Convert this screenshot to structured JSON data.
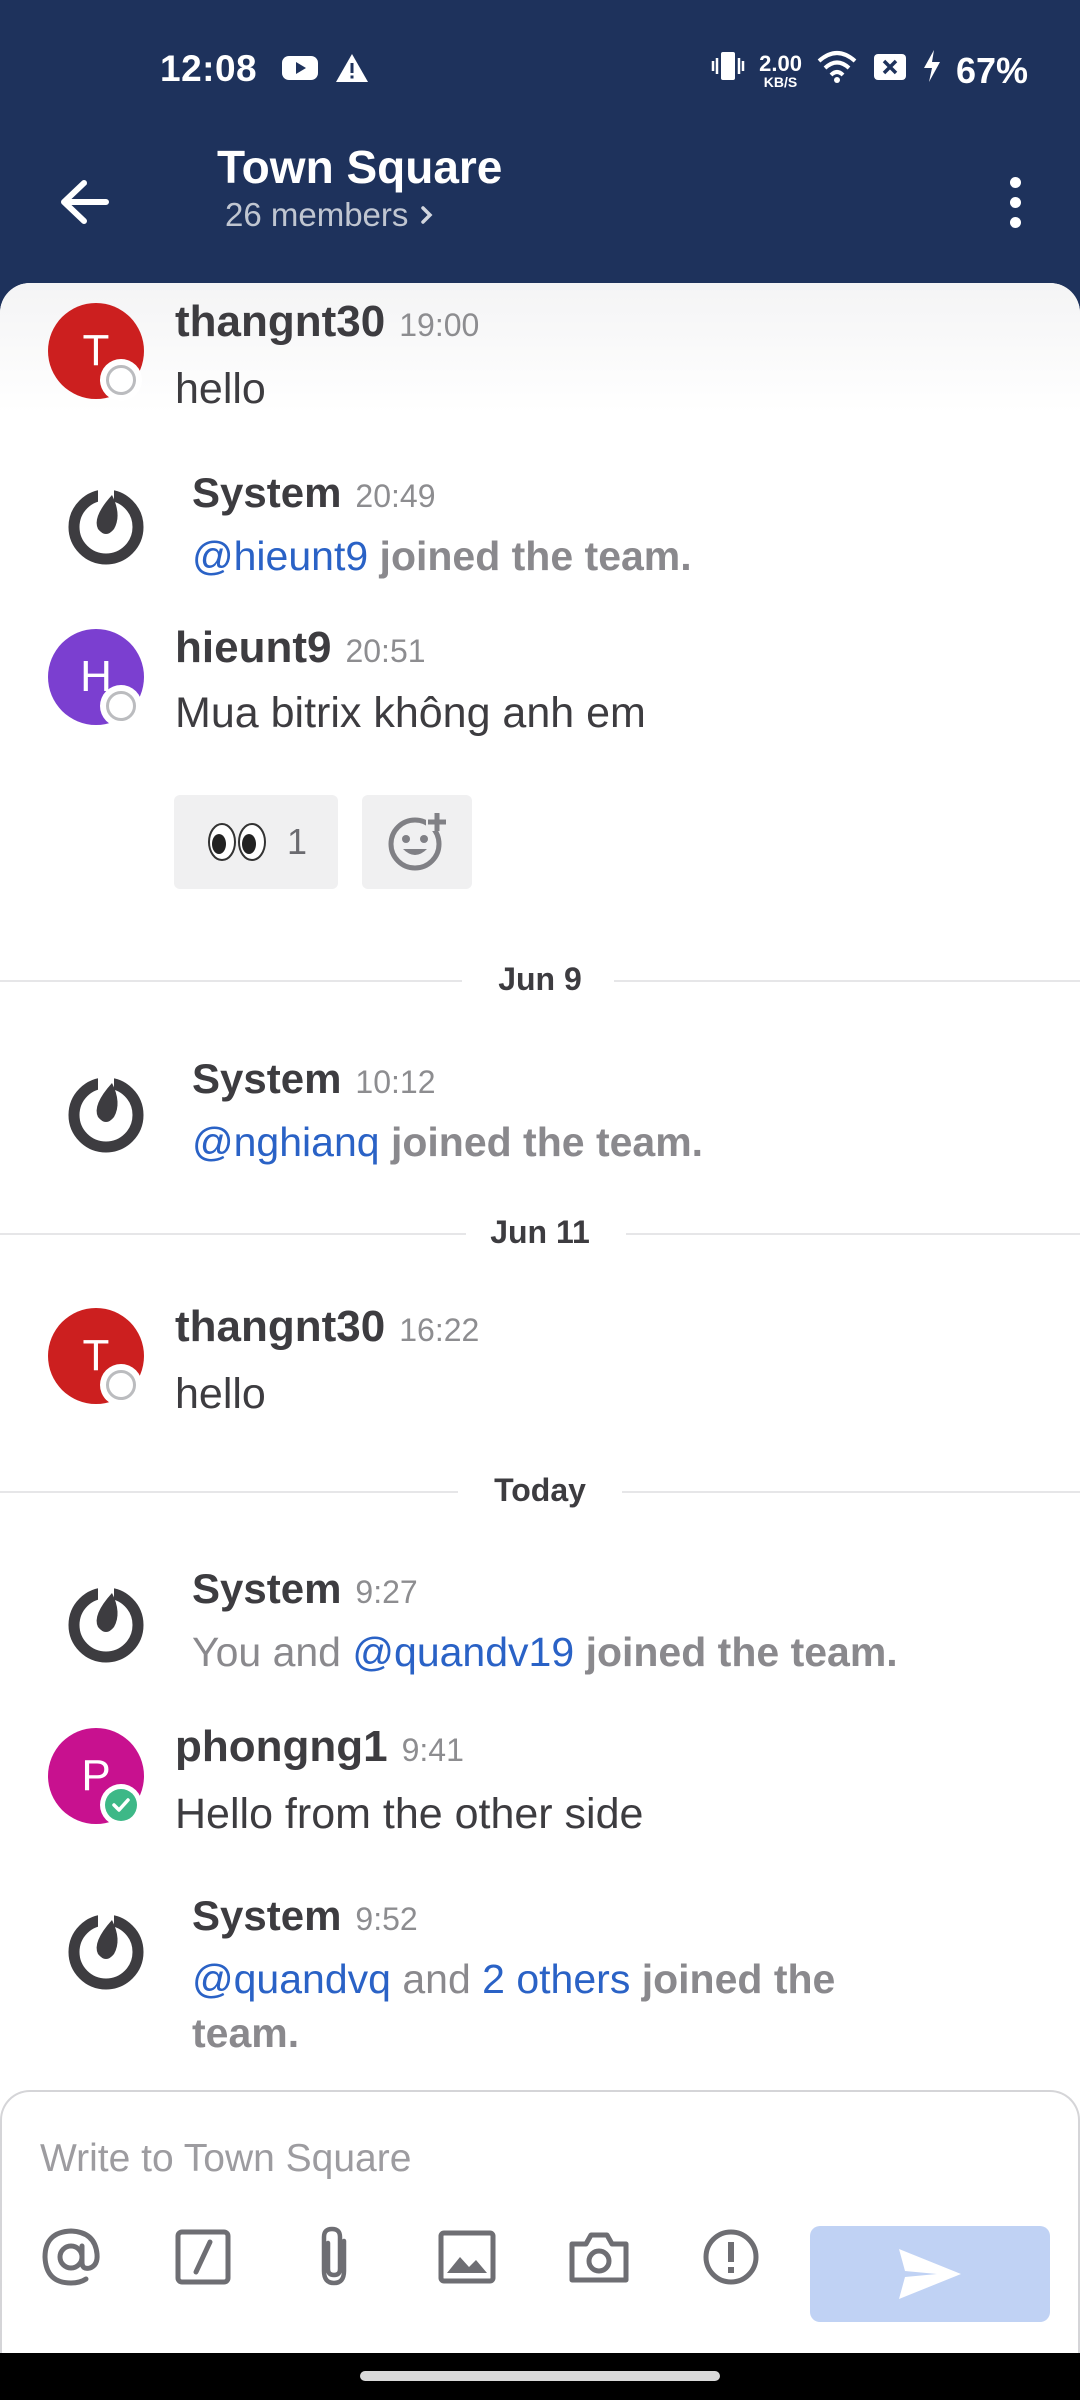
{
  "status_bar": {
    "time": "12:08",
    "net_speed_value": "2.00",
    "net_speed_unit": "KB/S",
    "battery": "67%"
  },
  "header": {
    "title": "Town Square",
    "subtitle": "26 members"
  },
  "posts": [
    {
      "author": "thangnt30",
      "time": "19:00",
      "message": "hello",
      "avatar_letter": "T",
      "avatar_color": "#cc1f1f",
      "status": "offline"
    },
    {
      "author": "System",
      "time": "20:49",
      "mention": "@hieunt9",
      "text": "joined the team."
    },
    {
      "author": "hieunt9",
      "time": "20:51",
      "message": "Mua bitrix không anh em",
      "avatar_letter": "H",
      "avatar_color": "#7b3fd0",
      "status": "offline",
      "reaction": {
        "emoji": "eyes-emoji",
        "count": "1"
      }
    },
    {
      "author": "System",
      "time": "10:12",
      "mention": "@nghianq",
      "text": "joined the team."
    },
    {
      "author": "thangnt30",
      "time": "16:22",
      "message": "hello",
      "avatar_letter": "T",
      "avatar_color": "#cc1f1f",
      "status": "offline"
    },
    {
      "author": "System",
      "time": "9:27",
      "prefix": "You and",
      "mention": "@quandv19",
      "text": "joined the team."
    },
    {
      "author": "phongng1",
      "time": "9:41",
      "message": "Hello from the other side",
      "avatar_letter": "P",
      "avatar_color": "#c8118f",
      "status": "online"
    },
    {
      "author": "System",
      "time": "9:52",
      "mention": "@quandvq",
      "middle": "and",
      "others": "2 others",
      "text": "joined the",
      "text2": "team."
    }
  ],
  "date_separators": [
    "Jun 9",
    "Jun 11",
    "Today"
  ],
  "composer": {
    "placeholder": "Write to Town Square"
  },
  "colors": {
    "header_bg": "#1e325c",
    "mention": "#2a62c6",
    "send_disabled": "#c0d2f4",
    "online": "#3db887"
  }
}
